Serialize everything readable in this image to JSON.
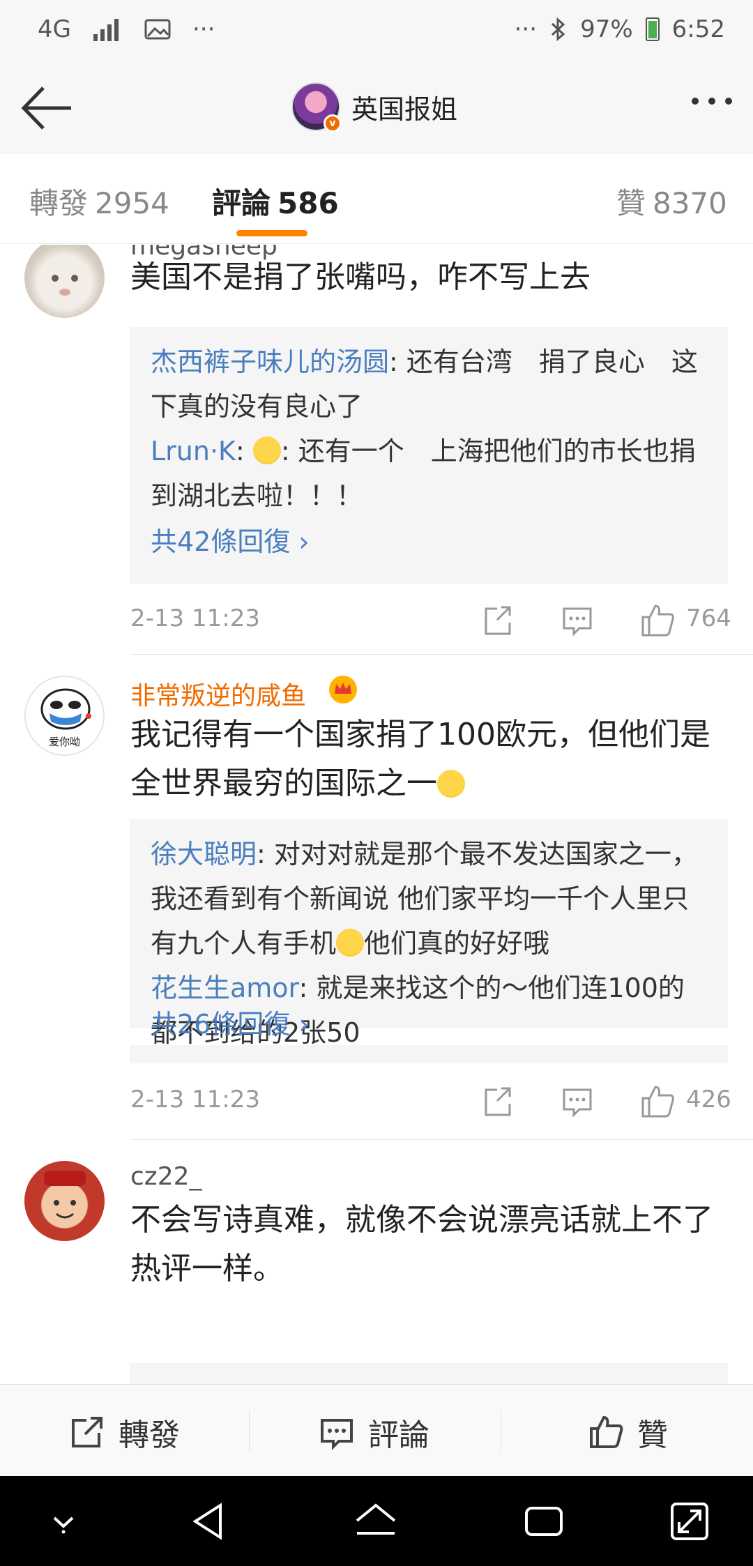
{
  "status_bar": {
    "network": "4G",
    "dots": "···",
    "right_dots": "···",
    "battery": "97%",
    "time": "6:52"
  },
  "header": {
    "title": "英国报姐",
    "avatar_icon": "profile-avatar",
    "verified_icon": "verified-badge"
  },
  "tabs": [
    {
      "label": "轉發",
      "count": "2954"
    },
    {
      "label": "評論",
      "count": "586"
    },
    {
      "label": "贊",
      "count": "8370"
    }
  ],
  "comments": [
    {
      "username": "megasheep",
      "text": "美国不是捐了张嘴吗，咋不写上去",
      "replies": [
        {
          "name": "杰西裤子味儿的汤圆",
          "text": ": 还有台湾　捐了良心　这下真的没有良心了"
        },
        {
          "name": "Lrun·K",
          "text": ": 还有一个　上海把他们的市长也捐到湖北去啦！！！"
        }
      ],
      "more_replies": "共42條回復 ›",
      "time": "2-13 11:23",
      "likes": "764"
    },
    {
      "username": "非常叛逆的咸鱼",
      "text": "我记得有一个国家捐了100欧元，但他们是全世界最穷的国际之一",
      "avatar_caption": "爱你呦",
      "replies": [
        {
          "name": "徐大聪明",
          "text": ": 对对对就是那个最不发达国家之一，我还看到有个新闻说 他们家平均一千个人里只有九个人有手机"
        },
        {
          "name": "",
          "text": "他们真的好好哦"
        },
        {
          "name": "花生生amor",
          "text": ": 就是来找这个的～他们连100的都不到给的2张50"
        }
      ],
      "more_replies": "共26條回復 ›",
      "time": "2-13 11:23",
      "likes": "426"
    },
    {
      "username": "cz22_",
      "text": "不会写诗真难，就像不会说漂亮话就上不了热评一样。"
    }
  ],
  "bottom_bar": {
    "repost": "轉發",
    "comment": "評論",
    "like": "贊"
  },
  "colors": {
    "accent": "#ff8200",
    "link": "#4a7ebf",
    "vip_name": "#f06c00"
  }
}
